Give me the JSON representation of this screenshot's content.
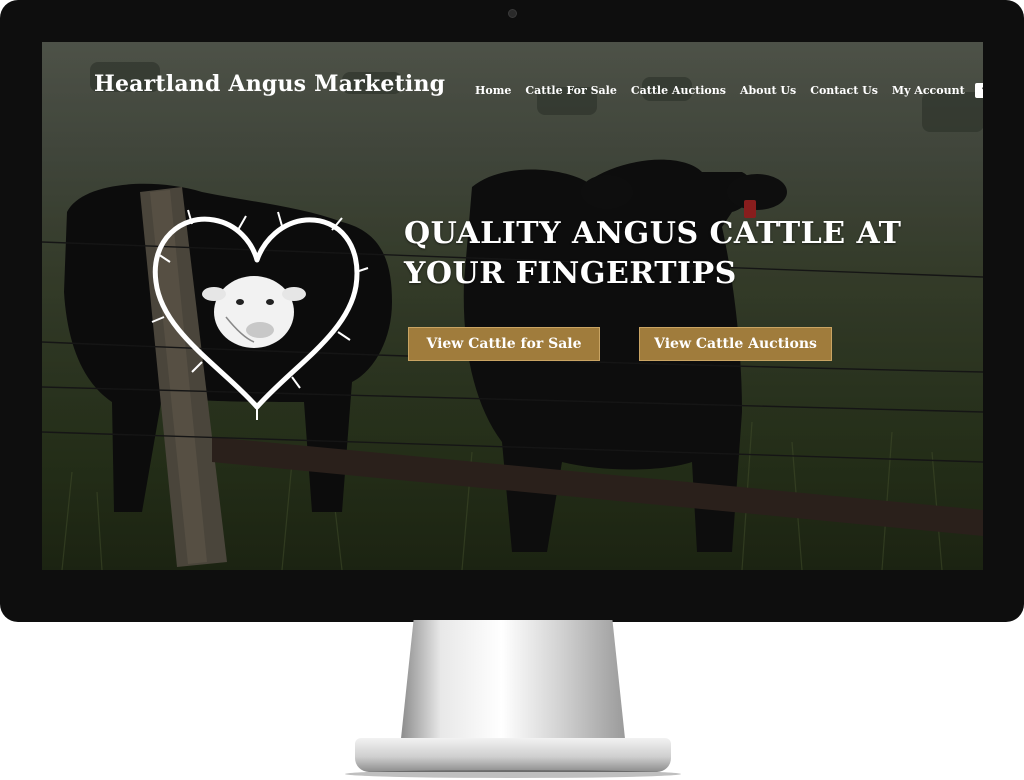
{
  "site": {
    "title": "Heartland Angus Marketing"
  },
  "nav": {
    "items": [
      {
        "label": "Home"
      },
      {
        "label": "Cattle For Sale"
      },
      {
        "label": "Cattle Auctions"
      },
      {
        "label": "About Us"
      },
      {
        "label": "Contact Us"
      },
      {
        "label": "My Account"
      }
    ],
    "social_icon": "facebook-icon"
  },
  "hero": {
    "headline_line1": "QUALITY ANGUS CATTLE AT",
    "headline_line2": "YOUR FINGERTIPS",
    "buttons": {
      "sale_label": "View Cattle for Sale",
      "auction_label": "View Cattle Auctions"
    },
    "logo_icon": "barbed-wire-heart-cow-icon"
  },
  "colors": {
    "button_bg": "#a07c3c",
    "button_border": "#c9a463",
    "text": "#ffffff",
    "bezel": "#0e0e0e"
  }
}
